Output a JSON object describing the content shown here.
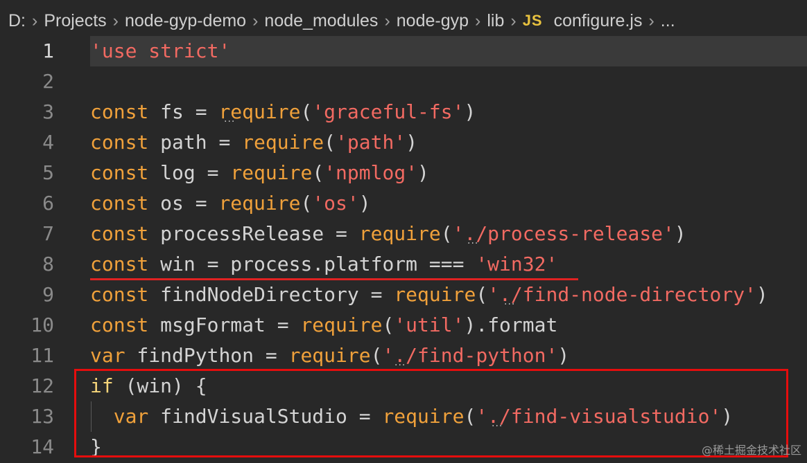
{
  "breadcrumb": {
    "items": [
      "D:",
      "Projects",
      "node-gyp-demo",
      "node_modules",
      "node-gyp",
      "lib"
    ],
    "file_icon": "JS",
    "file_name": "configure.js",
    "ellipsis": "..."
  },
  "editor": {
    "lines": [
      {
        "number": "1",
        "tokens": [
          {
            "t": "str",
            "v": "'use strict'"
          }
        ]
      },
      {
        "number": "2",
        "tokens": []
      },
      {
        "number": "3",
        "tokens": [
          {
            "t": "kw",
            "v": "const"
          },
          {
            "t": "id",
            "v": " fs = "
          },
          {
            "t": "fn",
            "v": "require"
          },
          {
            "t": "pn",
            "v": "("
          },
          {
            "t": "str",
            "v": "'graceful-fs'"
          },
          {
            "t": "pn",
            "v": ")"
          }
        ]
      },
      {
        "number": "4",
        "tokens": [
          {
            "t": "kw",
            "v": "const"
          },
          {
            "t": "id",
            "v": " path = "
          },
          {
            "t": "fn",
            "v": "require"
          },
          {
            "t": "pn",
            "v": "("
          },
          {
            "t": "str",
            "v": "'path'"
          },
          {
            "t": "pn",
            "v": ")"
          }
        ]
      },
      {
        "number": "5",
        "tokens": [
          {
            "t": "kw",
            "v": "const"
          },
          {
            "t": "id",
            "v": " log = "
          },
          {
            "t": "fn",
            "v": "require"
          },
          {
            "t": "pn",
            "v": "("
          },
          {
            "t": "str",
            "v": "'npmlog'"
          },
          {
            "t": "pn",
            "v": ")"
          }
        ]
      },
      {
        "number": "6",
        "tokens": [
          {
            "t": "kw",
            "v": "const"
          },
          {
            "t": "id",
            "v": " os = "
          },
          {
            "t": "fn",
            "v": "require"
          },
          {
            "t": "pn",
            "v": "("
          },
          {
            "t": "str",
            "v": "'os'"
          },
          {
            "t": "pn",
            "v": ")"
          }
        ]
      },
      {
        "number": "7",
        "tokens": [
          {
            "t": "kw",
            "v": "const"
          },
          {
            "t": "id",
            "v": " processRelease = "
          },
          {
            "t": "fn",
            "v": "require"
          },
          {
            "t": "pn",
            "v": "("
          },
          {
            "t": "str",
            "v": "'./process-release'"
          },
          {
            "t": "pn",
            "v": ")"
          }
        ]
      },
      {
        "number": "8",
        "tokens": [
          {
            "t": "kw",
            "v": "const"
          },
          {
            "t": "id",
            "v": " win = process.platform === "
          },
          {
            "t": "str",
            "v": "'win32'"
          }
        ]
      },
      {
        "number": "9",
        "tokens": [
          {
            "t": "kw",
            "v": "const"
          },
          {
            "t": "id",
            "v": " findNodeDirectory = "
          },
          {
            "t": "fn",
            "v": "require"
          },
          {
            "t": "pn",
            "v": "("
          },
          {
            "t": "str",
            "v": "'./find-node-directory'"
          },
          {
            "t": "pn",
            "v": ")"
          }
        ]
      },
      {
        "number": "10",
        "tokens": [
          {
            "t": "kw",
            "v": "const"
          },
          {
            "t": "id",
            "v": " msgFormat = "
          },
          {
            "t": "fn",
            "v": "require"
          },
          {
            "t": "pn",
            "v": "("
          },
          {
            "t": "str",
            "v": "'util'"
          },
          {
            "t": "pn",
            "v": ").format"
          }
        ]
      },
      {
        "number": "11",
        "tokens": [
          {
            "t": "kw",
            "v": "var"
          },
          {
            "t": "id",
            "v": " findPython = "
          },
          {
            "t": "fn",
            "v": "require"
          },
          {
            "t": "pn",
            "v": "("
          },
          {
            "t": "str",
            "v": "'./find-python'"
          },
          {
            "t": "pn",
            "v": ")"
          }
        ]
      },
      {
        "number": "12",
        "tokens": [
          {
            "t": "kw2",
            "v": "if"
          },
          {
            "t": "id",
            "v": " (win) {"
          }
        ]
      },
      {
        "number": "13",
        "tokens": [
          {
            "t": "id",
            "v": "  "
          },
          {
            "t": "kw",
            "v": "var"
          },
          {
            "t": "id",
            "v": " findVisualStudio = "
          },
          {
            "t": "fn",
            "v": "require"
          },
          {
            "t": "pn",
            "v": "("
          },
          {
            "t": "str",
            "v": "'./find-visualstudio'"
          },
          {
            "t": "pn",
            "v": ")"
          }
        ]
      },
      {
        "number": "14",
        "tokens": [
          {
            "t": "id",
            "v": "}"
          }
        ]
      }
    ]
  },
  "watermark": "@稀土掘金技术社区",
  "colors": {
    "background": "#282828",
    "keyword": "#f0a13b",
    "string": "#f26a62",
    "annotation_red": "#e60d0d"
  }
}
